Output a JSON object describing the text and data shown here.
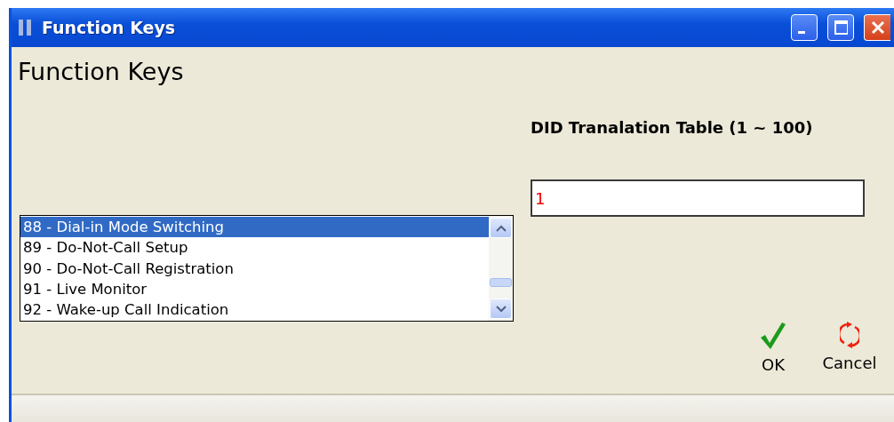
{
  "window": {
    "title": "Function Keys"
  },
  "heading": "Function Keys",
  "field_label": "DID Tranalation Table (1 ~ 100)",
  "list_items": [
    {
      "label": "88 - Dial-in Mode Switching",
      "selected": true
    },
    {
      "label": "89 - Do-Not-Call Setup",
      "selected": false
    },
    {
      "label": "90 - Do-Not-Call Registration",
      "selected": false
    },
    {
      "label": "91 - Live Monitor",
      "selected": false
    },
    {
      "label": "92 - Wake-up Call Indication",
      "selected": false
    }
  ],
  "field_value": "1",
  "buttons": [
    {
      "kind": "ok",
      "label": "OK"
    },
    {
      "kind": "cancel",
      "label": "Cancel"
    }
  ]
}
